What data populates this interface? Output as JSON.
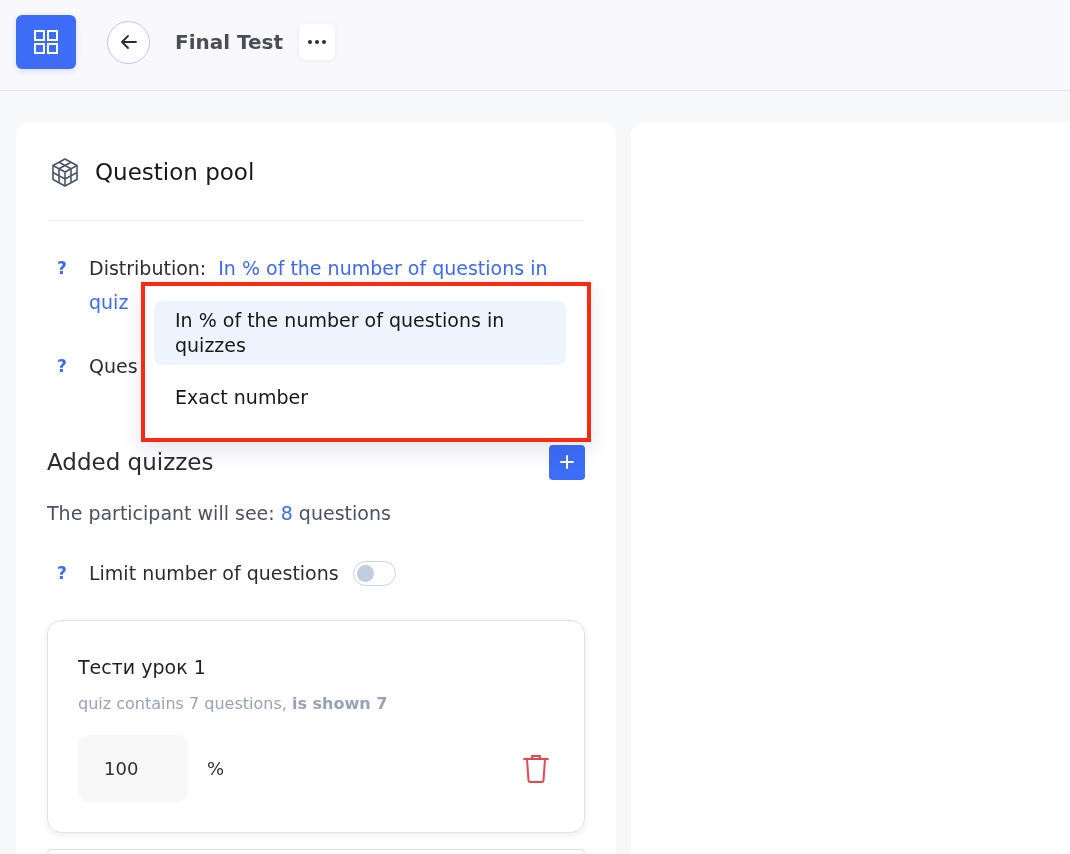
{
  "top_bar": {
    "title": "Final Test"
  },
  "question_pool": {
    "title": "Question pool",
    "settings": [
      {
        "kind": "select",
        "hint": "?",
        "label": "Distribution:",
        "value_lines": [
          "In % of the number of questions in",
          "quiz"
        ]
      },
      {
        "kind": "plain",
        "hint": "?",
        "label": "Ques"
      }
    ],
    "dropdown": {
      "options": [
        {
          "label": "In % of the number of questions in quizzes",
          "selected": true
        },
        {
          "label": "Exact number",
          "selected": false
        }
      ]
    }
  },
  "added_quizzes": {
    "title": "Added quizzes",
    "summary": {
      "prefix": "The participant will see:",
      "count": "8",
      "suffix": "questions"
    },
    "limit": {
      "hint": "?",
      "label": "Limit number of questions",
      "on": false
    },
    "quizzes": [
      {
        "title": "Тести урок 1",
        "info": "quiz contains 7 questions, **is shown 7**",
        "value": "100",
        "unit": "%"
      }
    ]
  }
}
